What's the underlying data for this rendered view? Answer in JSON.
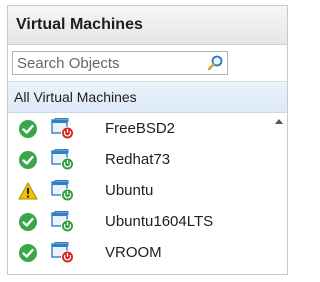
{
  "panel": {
    "title": "Virtual Machines"
  },
  "search": {
    "placeholder": "Search Objects",
    "icon": "search-icon"
  },
  "group": {
    "label": "All Virtual Machines"
  },
  "colors": {
    "ok": "#3aa64a",
    "warning": "#f2c200",
    "vm_blue": "#2f7fc8",
    "down_red": "#d9261c",
    "up_green": "#2e9e3f"
  },
  "vms": [
    {
      "name": "FreeBSD2",
      "health": "ok",
      "power": "off"
    },
    {
      "name": "Redhat73",
      "health": "ok",
      "power": "on"
    },
    {
      "name": "Ubuntu",
      "health": "warning",
      "power": "on"
    },
    {
      "name": "Ubuntu1604LTS",
      "health": "ok",
      "power": "on"
    },
    {
      "name": "VROOM",
      "health": "ok",
      "power": "off"
    }
  ]
}
